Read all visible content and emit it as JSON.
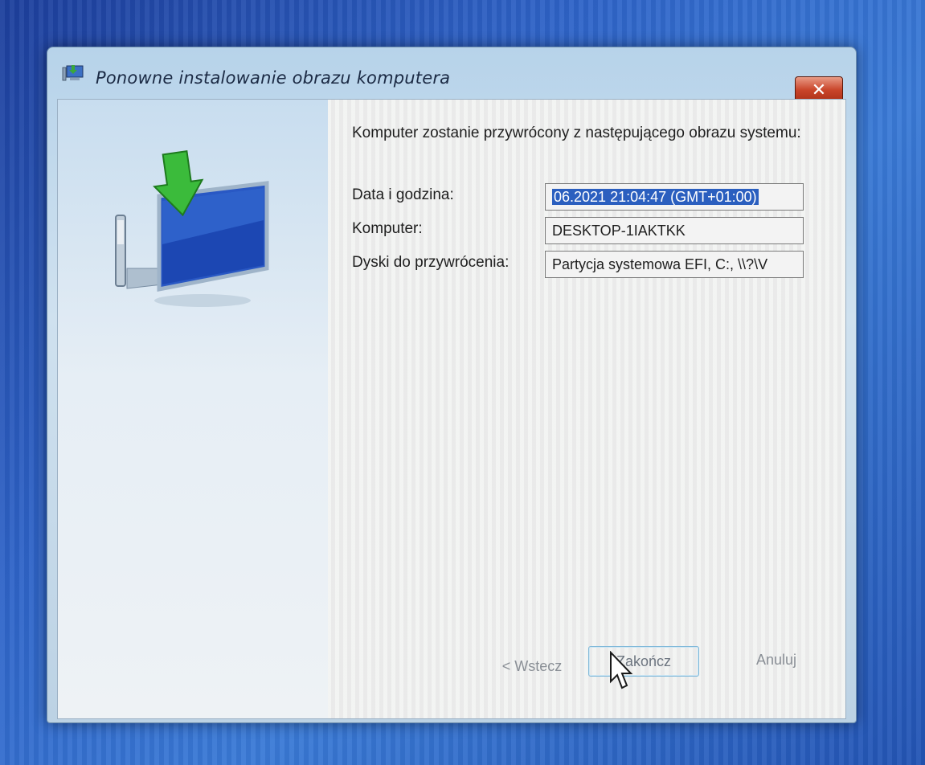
{
  "window": {
    "title": "Ponowne instalowanie obrazu komputera",
    "close_label": "✕"
  },
  "main": {
    "description": "Komputer zostanie przywrócony z następującego obrazu systemu:",
    "rows": [
      {
        "label": "Data i godzina:",
        "value": "06.2021 21:04:47 (GMT+01:00)"
      },
      {
        "label": "Komputer:",
        "value": "DESKTOP-1IAKTKK"
      },
      {
        "label": "Dyski do przywrócenia:",
        "value": "Partycja systemowa EFI, C:, \\\\?\\V"
      }
    ]
  },
  "buttons": {
    "back": "< Wstecz",
    "finish": "Zakończ",
    "cancel": "Anuluj"
  },
  "colors": {
    "selection": "#2b5fbf",
    "close_button": "#c9452a"
  }
}
